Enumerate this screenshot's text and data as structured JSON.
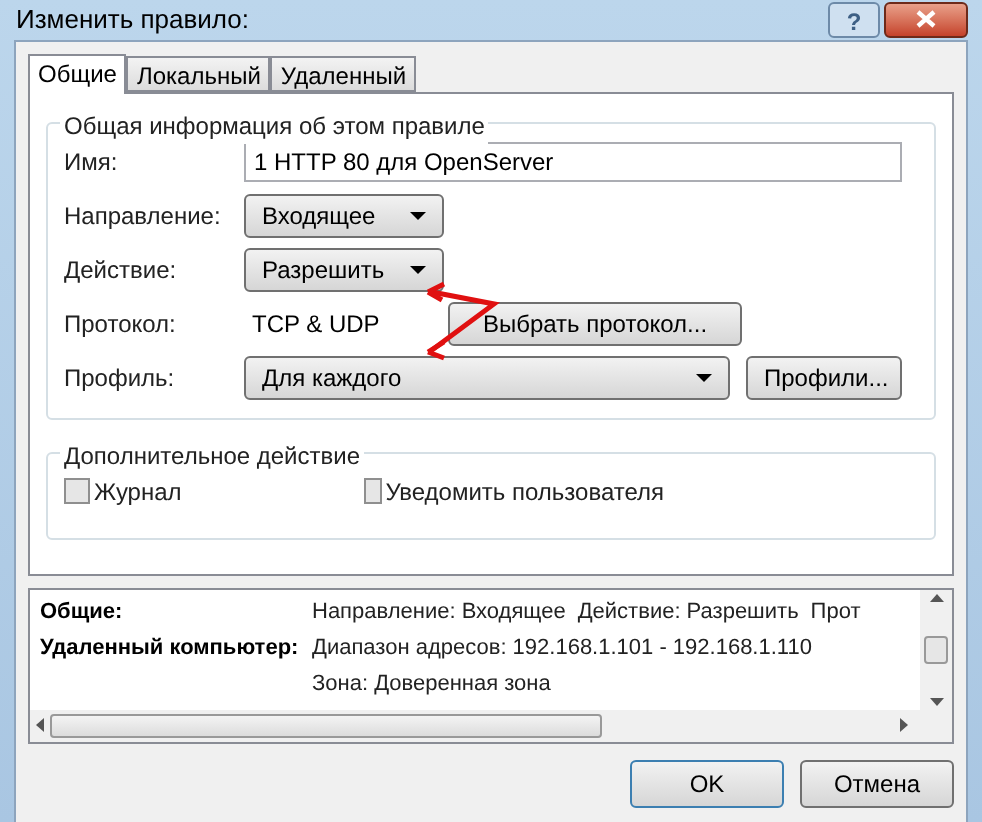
{
  "window": {
    "title": "Изменить правило:",
    "help": "?"
  },
  "tabs": [
    {
      "label": "Общие",
      "selected": true
    },
    {
      "label": "Локальный",
      "selected": false
    },
    {
      "label": "Удаленный",
      "selected": false
    }
  ],
  "general_group": {
    "title": "Общая информация об этом правиле",
    "fields": [
      {
        "kind": "text",
        "label": "Имя:",
        "value": "1 HTTP 80 для OpenServer"
      },
      {
        "kind": "dropdown",
        "label": "Направление:",
        "value": "Входящее"
      },
      {
        "kind": "dropdown",
        "label": "Действие:",
        "value": "Разрешить"
      },
      {
        "kind": "readonly",
        "label": "Протокол:",
        "value": "TCP & UDP",
        "button": "Выбрать протокол..."
      },
      {
        "kind": "wide_dropdown",
        "label": "Профиль:",
        "value": "Для каждого",
        "button": "Профили..."
      }
    ]
  },
  "extra_group": {
    "title": "Дополнительное действие",
    "options": [
      {
        "label": "Журнал",
        "checked": false
      },
      {
        "label": "Уведомить пользователя",
        "checked": false
      }
    ]
  },
  "summary": [
    {
      "label": "Общие:",
      "values": [
        "Направление: Входящее",
        "Действие: Разрешить",
        "Прот"
      ]
    },
    {
      "label": "Удаленный компьютер:",
      "values": [
        "Диапазон адресов: 192.168.1.101 - 192.168.1.110"
      ]
    },
    {
      "values": [
        "Зона: Доверенная зона"
      ]
    }
  ],
  "buttons": [
    {
      "label": "OK",
      "default": true
    },
    {
      "label": "Отмена",
      "default": false
    }
  ]
}
